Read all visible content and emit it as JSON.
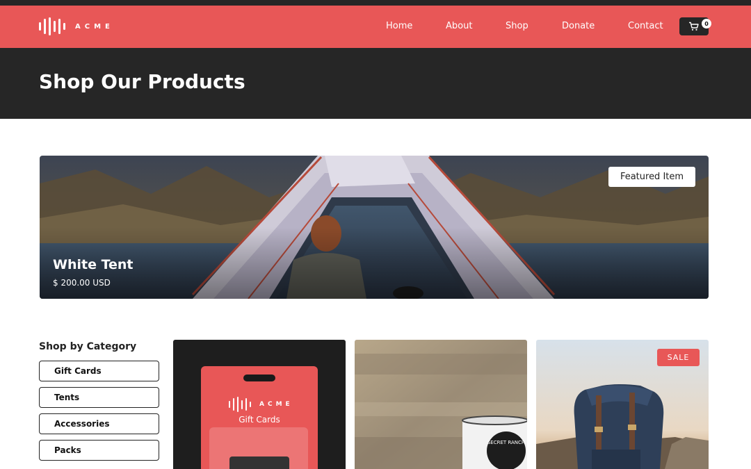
{
  "brand": {
    "name": "ACME",
    "accent": "#e85757",
    "dark": "#262626"
  },
  "nav": {
    "items": [
      {
        "label": "Home"
      },
      {
        "label": "About"
      },
      {
        "label": "Shop"
      },
      {
        "label": "Donate"
      },
      {
        "label": "Contact"
      }
    ],
    "cart_icon": "shopping-cart-icon",
    "cart_count": "0"
  },
  "header": {
    "title": "Shop Our Products"
  },
  "featured": {
    "badge": "Featured Item",
    "name": "White Tent",
    "price": "$ 200.00 USD"
  },
  "categories": {
    "title": "Shop by Category",
    "items": [
      {
        "label": "Gift Cards"
      },
      {
        "label": "Tents"
      },
      {
        "label": "Accessories"
      },
      {
        "label": "Packs"
      }
    ]
  },
  "products": [
    {
      "image": "gift-card-image",
      "card_brand": "ACME",
      "card_label": "Gift Cards"
    },
    {
      "image": "enamel-mug-image",
      "mug_text": "SECRET RANCH"
    },
    {
      "image": "backpack-image",
      "badge": "SALE"
    }
  ]
}
